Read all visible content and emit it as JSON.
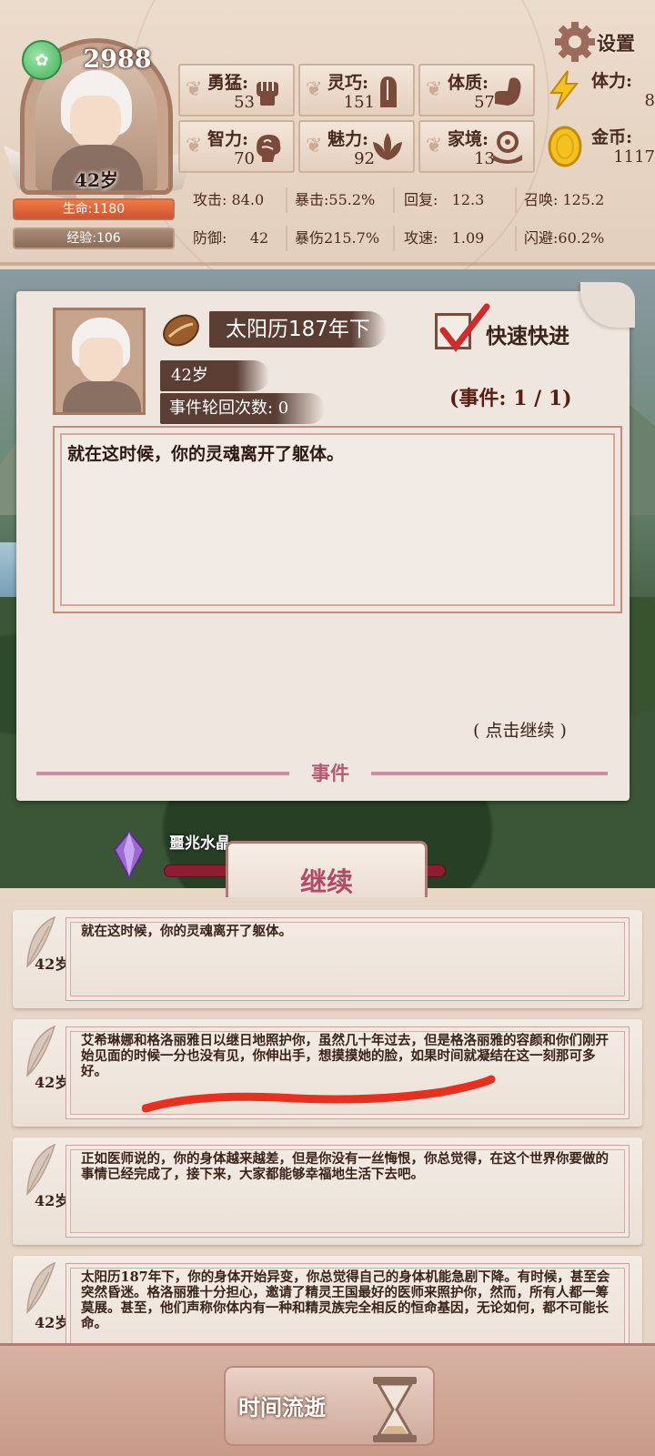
{
  "hud": {
    "spirit_points": "2988",
    "age": "42岁",
    "hp": "生命:1180",
    "exp": "经验:106",
    "settings_label": "设置",
    "attributes": [
      {
        "label": "勇猛:",
        "value": "53",
        "icon": "fist-icon"
      },
      {
        "label": "灵巧:",
        "value": "151",
        "icon": "hand-icon"
      },
      {
        "label": "体质:",
        "value": "57",
        "icon": "arm-icon"
      },
      {
        "label": "智力:",
        "value": "70",
        "icon": "brain-icon"
      },
      {
        "label": "魅力:",
        "value": "92",
        "icon": "lotus-icon"
      },
      {
        "label": "家境:",
        "value": "13",
        "icon": "coin-hand-icon"
      }
    ],
    "resources": [
      {
        "label": "体力:",
        "value": "8",
        "icon": "lightning-icon"
      },
      {
        "label": "金币:",
        "value": "1117",
        "icon": "gold-coin-icon"
      }
    ],
    "combat_row1": [
      {
        "label": "攻击:",
        "value": "84.0"
      },
      {
        "label": "暴击:",
        "value": "55.2%"
      },
      {
        "label": "回复:",
        "value": "12.3"
      },
      {
        "label": "召唤:",
        "value": "125.2"
      }
    ],
    "combat_row2": [
      {
        "label": "防御:",
        "value": "42"
      },
      {
        "label": "暴伤",
        "value": "215.7%"
      },
      {
        "label": "攻速:",
        "value": "1.09"
      },
      {
        "label": "闪避:",
        "value": "60.2%"
      }
    ]
  },
  "event": {
    "date": "太阳历187年下",
    "age": "42岁",
    "cycles": "事件轮回次数: 0",
    "fast_forward_label": "快速快进",
    "fast_forward_checked": true,
    "counter": "(事件: 1 / 1)",
    "text": "就在这时候，你的灵魂离开了躯体。",
    "hint": "( 点击继续 )",
    "footer_label": "事件"
  },
  "omen": {
    "label": "噩兆水晶",
    "continue_label": "继续"
  },
  "log": [
    {
      "age": "42岁",
      "text": "就在这时候，你的灵魂离开了躯体。"
    },
    {
      "age": "42岁",
      "text": "艾希琳娜和格洛丽雅日以继日地照护你，虽然几十年过去，但是格洛丽雅的容颜和你们刚开始见面的时候一分也没有见，你伸出手，想摸摸她的脸，如果时间就凝结在这一刻那可多好。"
    },
    {
      "age": "42岁",
      "text": "正如医师说的，你的身体越来越差，但是你没有一丝悔恨，你总觉得，在这个世界你要做的事情已经完成了，接下来，大家都能够幸福地生活下去吧。"
    },
    {
      "age": "42岁",
      "text": "太阳历187年下，你的身体开始异变，你总觉得自己的身体机能急剧下降。有时候，甚至会突然昏迷。格洛丽雅十分担心，邀请了精灵王国最好的医师来照护你，然而，所有人都一筹莫展。甚至，他们声称你体内有一种和精灵族完全相反的恒命基因，无论如何，都不可能长命。"
    }
  ],
  "bottom": {
    "time_label": "时间流逝"
  },
  "colors": {
    "accent": "#b04a66",
    "hp": "#e0643a",
    "panel": "#efe7df",
    "text_dark": "#4a2a1e"
  }
}
